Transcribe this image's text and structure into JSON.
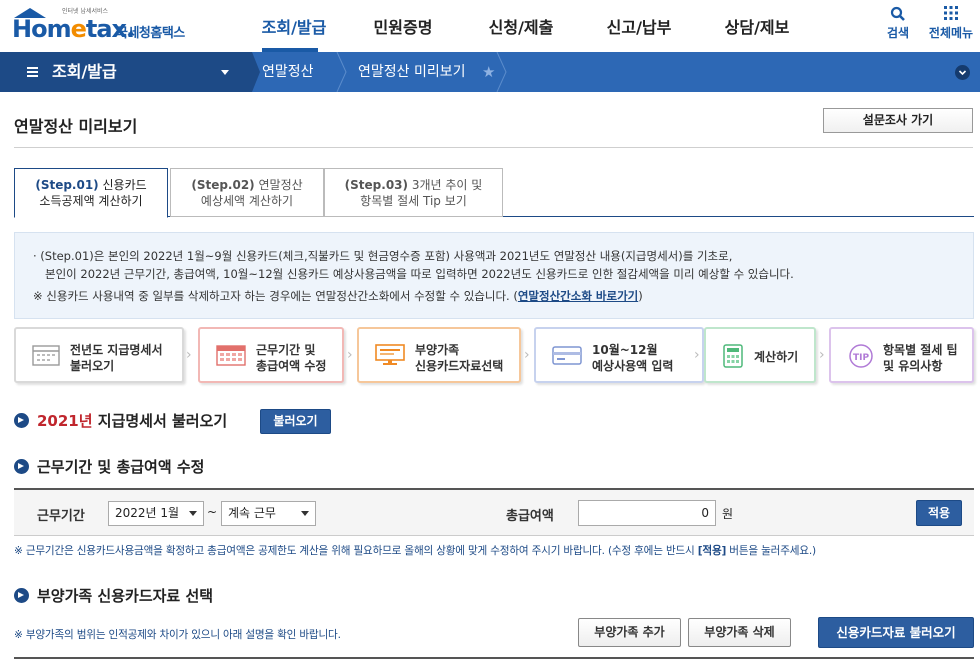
{
  "header": {
    "logo_sub": "인터넷 납세서비스",
    "logo_main_a": "Hom",
    "logo_main_e": "e",
    "logo_main_b": "tax.",
    "logo_kor": "국세청홈택스",
    "nav": [
      "조회/발급",
      "민원증명",
      "신청/제출",
      "신고/납부",
      "상담/제보"
    ],
    "search_label": "검색",
    "all_menu_label": "전체메뉴"
  },
  "location": {
    "menu": "조회/발급",
    "crumbs": [
      "연말정산",
      "연말정산 미리보기"
    ]
  },
  "page": {
    "title": "연말정산 미리보기",
    "survey_button": "설문조사 가기"
  },
  "tabs": [
    {
      "step": "(Step.01)",
      "line1": "신용카드",
      "line2": "소득공제액 계산하기"
    },
    {
      "step": "(Step.02)",
      "line1": "연말정산",
      "line2": "예상세액 계산하기"
    },
    {
      "step": "(Step.03)",
      "line1": "3개년 추이 및",
      "line2": "항목별 절세 Tip 보기"
    }
  ],
  "info": {
    "line1": "· (Step.01)은 본인의 2022년 1월~9월 신용카드(체크,직불카드 및 현금영수증 포함) 사용액과 2021년도 연말정산 내용(지급명세서)를 기초로,",
    "line2": "본인이 2022년 근무기간, 총급여액, 10월~12월 신용카드 예상사용금액을 따로 입력하면 2022년도 신용카드로 인한 절감세액을 미리 예상할 수 있습니다.",
    "line3": "※ 신용카드 사용내역 중 일부를 삭제하고자 하는 경우에는 연말정산간소화에서 수정할 수 있습니다. (",
    "line3_link": "연말정산간소화 바로가기",
    "line3_end": ")"
  },
  "process": [
    {
      "line1": "전년도 지급명세서",
      "line2": "불러오기",
      "icon": "calendar-icon",
      "color": "#888888"
    },
    {
      "line1": "근무기간 및",
      "line2": "총급여액 수정",
      "icon": "calendar-grid-icon",
      "color": "#e2706b"
    },
    {
      "line1": "부양가족",
      "line2": "신용카드자료선택",
      "icon": "monitor-icon",
      "color": "#f08a24"
    },
    {
      "line1": "10월~12월",
      "line2": "예상사용액 입력",
      "icon": "card-icon",
      "color": "#7f95d2"
    },
    {
      "line1": "계산하기",
      "line2": "",
      "icon": "calculator-icon",
      "color": "#4fb97a"
    },
    {
      "line1": "항목별 절세 팁",
      "line2": "및 유의사항",
      "icon": "tip-icon",
      "color": "#b07ad6"
    }
  ],
  "section1": {
    "year": "2021년",
    "title": " 지급명세서 불러오기",
    "button": "불러오기"
  },
  "section2": {
    "title": "근무기간 및 총급여액 수정",
    "period_label": "근무기간",
    "period_start": "2022년 1월",
    "tilde": "~",
    "period_end": "계속 근무",
    "salary_label": "총급여액",
    "salary_value": "0",
    "unit": "원",
    "apply_button": "적용",
    "note_a": "※ 근무기간은 신용카드사용금액을 확정하고 총급여액은 공제한도 계산을 위해 필요하므로 올해의 상황에 맞게 수정하여 주시기 바랍니다. (수정 후에는 반드시 ",
    "note_b": "[적용]",
    "note_c": " 버튼을 눌러주세요.)"
  },
  "section3": {
    "title": "부양가족 신용카드자료 선택",
    "note": "※ 부양가족의 범위는 인적공제와 차이가 있으니 아래 설명을 확인 바랍니다.",
    "add_button": "부양가족 추가",
    "delete_button": "부양가족 삭제",
    "load_button": "신용카드자료 불러오기"
  },
  "colors": {
    "brand": "#1a5aa6",
    "locbar": "#2d68b5",
    "locbar_dark": "#1d4a86",
    "accent_red": "#c0262d"
  }
}
